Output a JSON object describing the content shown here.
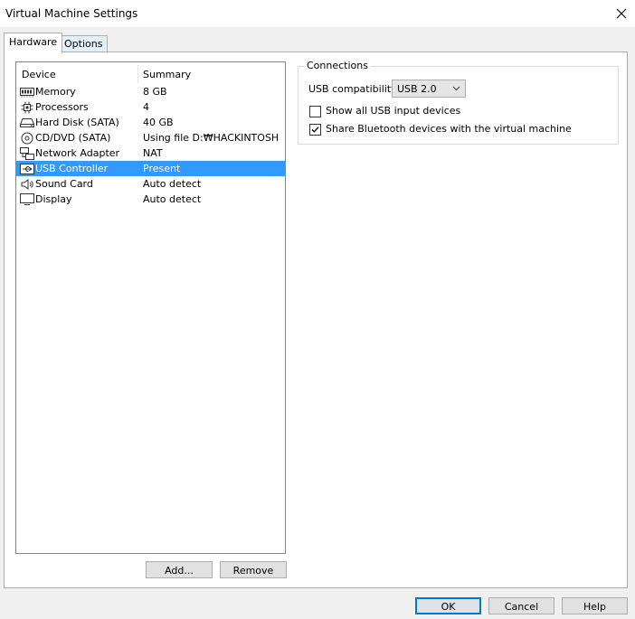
{
  "window": {
    "title": "Virtual Machine Settings"
  },
  "tabs": [
    {
      "label": "Hardware",
      "active": true
    },
    {
      "label": "Options",
      "active": false
    }
  ],
  "device_list": {
    "columns": [
      "Device",
      "Summary"
    ],
    "rows": [
      {
        "icon": "memory-icon",
        "device": "Memory",
        "summary": "8 GB",
        "selected": false
      },
      {
        "icon": "processor-icon",
        "device": "Processors",
        "summary": "4",
        "selected": false
      },
      {
        "icon": "hard-disk-icon",
        "device": "Hard Disk (SATA)",
        "summary": "40 GB",
        "selected": false
      },
      {
        "icon": "cd-dvd-icon",
        "device": "CD/DVD (SATA)",
        "summary": "Using file D:₩HACKINTOSH...",
        "selected": false
      },
      {
        "icon": "network-adapter-icon",
        "device": "Network Adapter",
        "summary": "NAT",
        "selected": false
      },
      {
        "icon": "usb-controller-icon",
        "device": "USB Controller",
        "summary": "Present",
        "selected": true
      },
      {
        "icon": "sound-card-icon",
        "device": "Sound Card",
        "summary": "Auto detect",
        "selected": false
      },
      {
        "icon": "display-icon",
        "device": "Display",
        "summary": "Auto detect",
        "selected": false
      }
    ]
  },
  "list_buttons": {
    "add": "Add...",
    "remove": "Remove"
  },
  "connections": {
    "title": "Connections",
    "compat_label": "USB compatibility:",
    "compat_value": "USB 2.0",
    "show_all_label": "Show all USB input devices",
    "show_all_checked": false,
    "share_bt_label": "Share Bluetooth devices with the virtual machine",
    "share_bt_checked": true
  },
  "footer": {
    "ok": "OK",
    "cancel": "Cancel",
    "help": "Help"
  },
  "colors": {
    "selection": "#3399ff",
    "accent": "#0078d7"
  }
}
